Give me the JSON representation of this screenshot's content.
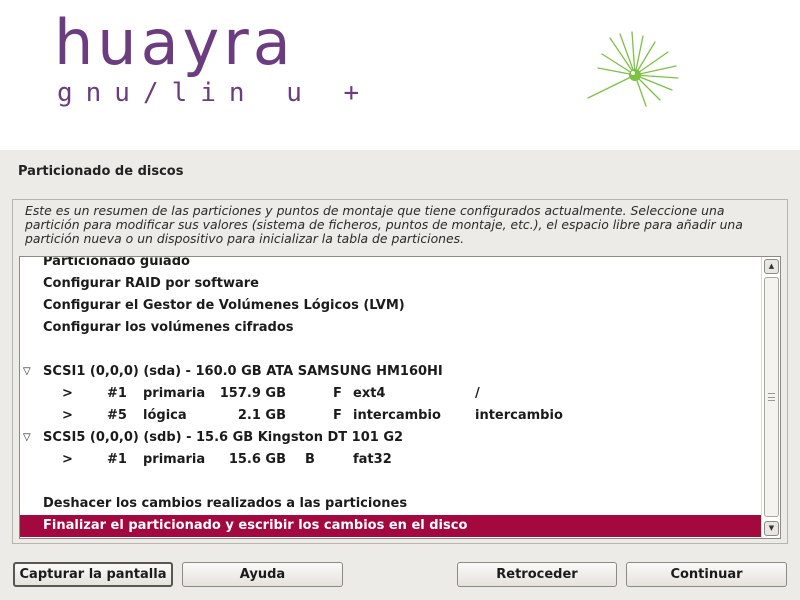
{
  "brand": {
    "logo_main": "huayra",
    "logo_sub": "gnu/lin u +"
  },
  "page": {
    "title": "Particionado de discos",
    "description": "Este es un resumen de las particiones y puntos de montaje que tiene configurados actualmente. Seleccione una partición para modificar sus valores (sistema de ficheros, puntos de montaje, etc.), el espacio libre para añadir una partición nueva o un dispositivo para inicializar la tabla de particiones."
  },
  "list": {
    "items": [
      {
        "label": "Particionado guiado"
      },
      {
        "label": "Configurar RAID por software"
      },
      {
        "label": "Configurar el Gestor de Volúmenes Lógicos (LVM)"
      },
      {
        "label": "Configurar los volúmenes cifrados"
      }
    ],
    "disks": [
      {
        "label": "SCSI1 (0,0,0) (sda) - 160.0 GB ATA SAMSUNG HM160HI",
        "partitions": [
          {
            "marker": ">",
            "num": "#1",
            "type": "primaria",
            "size": "157.9 GB",
            "flag": "F",
            "fs": "ext4",
            "mount": "/"
          },
          {
            "marker": ">",
            "num": "#5",
            "type": "lógica",
            "size": "2.1 GB",
            "flag": "F",
            "fs": "intercambio",
            "mount": "intercambio"
          }
        ]
      },
      {
        "label": "SCSI5 (0,0,0) (sdb) - 15.6 GB Kingston DT 101 G2",
        "partitions": [
          {
            "marker": ">",
            "num": "#1",
            "type": "primaria",
            "size": "15.6 GB",
            "flag": "B",
            "fs": "fat32",
            "mount": ""
          }
        ]
      }
    ],
    "undo_label": "Deshacer los cambios realizados a las particiones",
    "finish_label": "Finalizar el particionado y escribir los cambios en el disco"
  },
  "buttons": {
    "screenshot": "Capturar la pantalla",
    "help": "Ayuda",
    "back": "Retroceder",
    "continue": "Continuar"
  },
  "icons": {
    "disk_expand": "triangle-down-icon",
    "scroll_up": "arrow-up-icon",
    "scroll_down": "arrow-down-icon",
    "logo_burst": "starburst-logo-icon"
  },
  "colors": {
    "brand_purple": "#6b3d80",
    "brand_green": "#7cc242",
    "selection": "#a3093f",
    "background": "#edebe7"
  }
}
